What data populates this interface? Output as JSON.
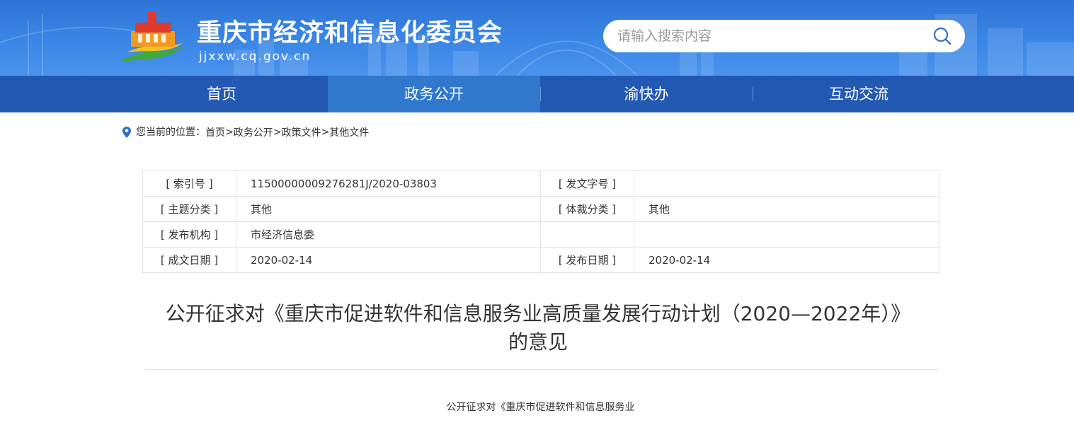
{
  "header": {
    "site_title": "重庆市经济和信息化委员会",
    "site_domain": "jjxxw.cq.gov.cn",
    "search_placeholder": "请输入搜索内容"
  },
  "nav": {
    "items": [
      {
        "label": "首页"
      },
      {
        "label": "政务公开"
      },
      {
        "label": "渝快办"
      },
      {
        "label": "互动交流"
      }
    ],
    "active_index": 1
  },
  "breadcrumb": {
    "prefix": "您当前的位置：",
    "items": [
      "首页",
      "政务公开",
      "政策文件",
      "其他文件"
    ],
    "separator": " >"
  },
  "meta": {
    "rows": [
      {
        "l1": "[ 索引号 ]",
        "v1": "11500000009276281J/2020-03803",
        "l2": "[ 发文字号 ]",
        "v2": ""
      },
      {
        "l1": "[ 主题分类 ]",
        "v1": "其他",
        "l2": "[ 体裁分类 ]",
        "v2": "其他"
      },
      {
        "l1": "[ 发布机构 ]",
        "v1": "市经济信息委",
        "l2": "",
        "v2": ""
      },
      {
        "l1": "[ 成文日期 ]",
        "v1": "2020-02-14",
        "l2": "[ 发布日期 ]",
        "v2": "2020-02-14"
      }
    ]
  },
  "document": {
    "title_line1": "公开征求对《重庆市促进软件和信息服务业高质量发展行动计划（2020—2022年）》",
    "title_line2": "的意见",
    "body_first_line": "公开征求对《重庆市促进软件和信息服务业"
  },
  "colors": {
    "header_blue": "#3a86e6",
    "nav_blue": "#2459b3",
    "nav_active": "#2f78cc",
    "logo_red": "#e03a2c",
    "logo_orange": "#f29a1f",
    "logo_green": "#3faa3a"
  }
}
